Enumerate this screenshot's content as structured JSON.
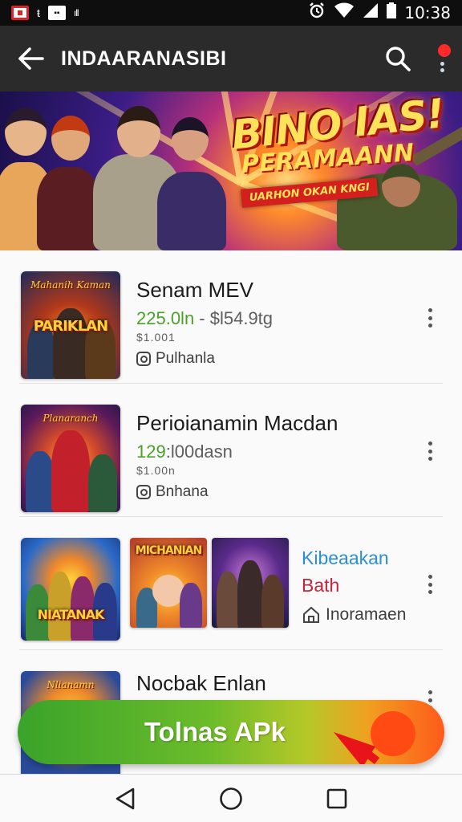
{
  "status_bar": {
    "time": "10:38",
    "left_icons": [
      "youtube-notif-icon",
      "t-notif-icon",
      "square-notif-icon",
      "vibrate-icon"
    ],
    "right_icons": [
      "alarm-icon",
      "wifi-icon",
      "signal-icon",
      "battery-icon"
    ]
  },
  "app_bar": {
    "title": "INDAARANASIBI",
    "icons": [
      "back-arrow-icon",
      "search-icon",
      "overflow-menu-icon"
    ],
    "notification_dot_color": "#ff2b2b"
  },
  "banner": {
    "title": "BINO IAS!",
    "subtitle": "PERAMAANN",
    "tag": "UARHON OKAN KNGI"
  },
  "items": [
    {
      "thumb_top": "Mahanih Kaman",
      "thumb_title": "PARIKLAN",
      "title": "Senam MEV",
      "price_green": "225.0ln",
      "price_rest": " - $l54.9tg",
      "small": "$1.001",
      "tag": "Pulhanla"
    },
    {
      "thumb_top": "Planaranch",
      "thumb_title": "",
      "title": "Perioianamin Macdan",
      "price_green": "129",
      "price_rest": ":l00dasn",
      "small": "$1.00n",
      "tag": "Bnhana"
    },
    {
      "thumb_title": "NIATANAK",
      "thumb2_title": "MICHANIAN",
      "blue_text": "Kibeaakan",
      "red_text": "Bath",
      "store_text": "Inoramaen"
    },
    {
      "thumb_top": "Nlianamn",
      "title": "Nocbak Enlan"
    }
  ],
  "cta": {
    "label": "Tolnas APk",
    "gradient": [
      "#3aa32a",
      "#b6c828",
      "#ff5a1a"
    ]
  },
  "nav_bar": {
    "icons": [
      "back-triangle-icon",
      "home-circle-icon",
      "recents-square-icon"
    ]
  }
}
